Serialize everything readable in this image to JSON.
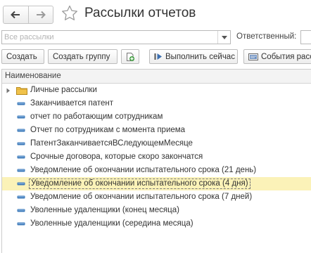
{
  "header": {
    "title": "Рассылки отчетов"
  },
  "filter": {
    "mailing_placeholder": "Все рассылки",
    "responsible_label": "Ответственный:",
    "responsible_value": ""
  },
  "toolbar": {
    "create_label": "Создать",
    "create_group_label": "Создать группу",
    "run_now_label": "Выполнить сейчас",
    "events_label": "События рассы"
  },
  "table": {
    "column_header": "Наименование",
    "rows": [
      {
        "label": "Личные рассылки",
        "type": "folder"
      },
      {
        "label": "Заканчивается патент",
        "type": "item"
      },
      {
        "label": "отчет по работающим сотрудникам",
        "type": "item"
      },
      {
        "label": "Отчет по сотрудникам с момента приема",
        "type": "item"
      },
      {
        "label": "ПатентЗаканчиваетсяВСледующемМесяце",
        "type": "item"
      },
      {
        "label": "Срочные договора, которые скоро закончатся",
        "type": "item"
      },
      {
        "label": "Уведомление об окончании испытательного срока (21 день)",
        "type": "item"
      },
      {
        "label": "Уведомление об окончании испытательного срока (4 дня)",
        "type": "item",
        "selected": true
      },
      {
        "label": "Уведомление об окончании испытательного срока (7 дней)",
        "type": "item"
      },
      {
        "label": "Уволенные удаленщики (конец месяца)",
        "type": "item"
      },
      {
        "label": "Уволенные удаленщики (середина месяца)",
        "type": "item"
      }
    ]
  },
  "icons": {
    "back": "arrow-left-icon",
    "forward": "arrow-right-icon",
    "favorite": "star-icon",
    "dropdown": "triangle-down-icon",
    "copy": "copy-add-icon",
    "run": "play-icon",
    "events": "event-log-icon",
    "folder": "folder-icon",
    "item": "mailing-item-icon",
    "expand": "expand-arrow-icon"
  },
  "colors": {
    "selected_row_bg": "#fbf2b8",
    "item_icon": "#3b78b8",
    "folder_icon": "#f0c24a",
    "copy_icon": "#3a9a3a"
  }
}
